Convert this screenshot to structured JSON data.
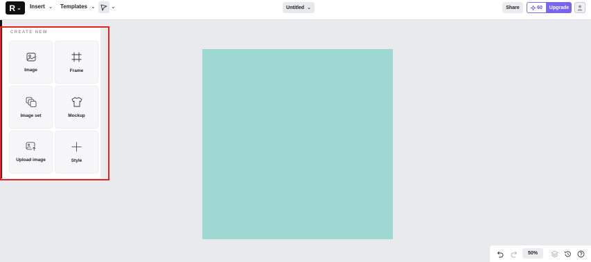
{
  "header": {
    "menus": [
      "Insert",
      "Templates"
    ],
    "document_title": "Untitled",
    "share_label": "Share",
    "credits": "60",
    "upgrade_label": "Upgrade"
  },
  "create_panel": {
    "section_title": "CREATE NEW",
    "tiles": [
      {
        "label": "Image",
        "icon": "image-icon"
      },
      {
        "label": "Frame",
        "icon": "frame-icon"
      },
      {
        "label": "Image set",
        "icon": "image-set-icon"
      },
      {
        "label": "Mockup",
        "icon": "tshirt-icon"
      },
      {
        "label": "Upload image",
        "icon": "upload-image-icon"
      },
      {
        "label": "Style",
        "icon": "style-icon"
      }
    ]
  },
  "canvas": {
    "artboard_color": "#9dd8d2"
  },
  "footer": {
    "zoom": "50%"
  },
  "colors": {
    "accent": "#7664f2",
    "highlight": "#e02222"
  }
}
